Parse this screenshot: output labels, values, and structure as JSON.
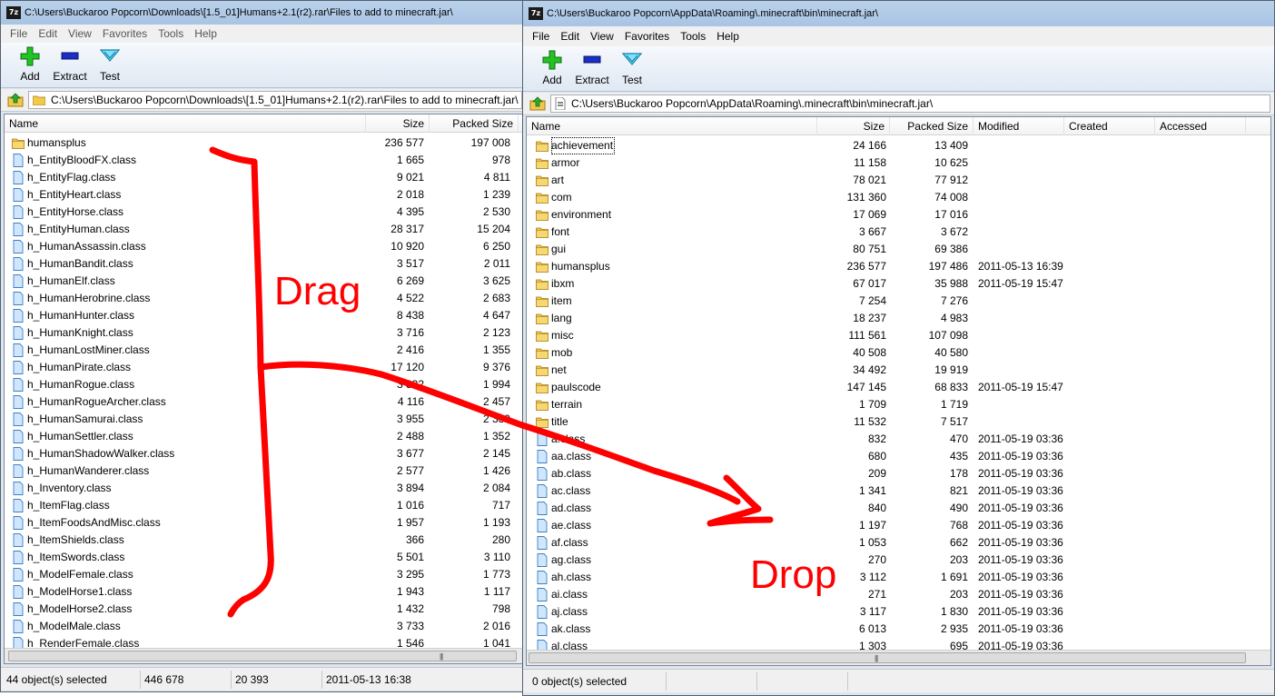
{
  "left": {
    "title": "C:\\Users\\Buckaroo Popcorn\\Downloads\\[1.5_01]Humans+2.1(r2).rar\\Files to add to minecraft.jar\\",
    "app_icon_text": "7z",
    "menu": [
      "File",
      "Edit",
      "View",
      "Favorites",
      "Tools",
      "Help"
    ],
    "toolbar": {
      "add": "Add",
      "extract": "Extract",
      "test": "Test"
    },
    "path": "C:\\Users\\Buckaroo Popcorn\\Downloads\\[1.5_01]Humans+2.1(r2).rar\\Files to add to minecraft.jar\\",
    "columns": {
      "name": "Name",
      "size": "Size",
      "packed": "Packed Size"
    },
    "rows": [
      {
        "name": "humansplus",
        "size": "236 577",
        "packed": "197 008",
        "type": "folder"
      },
      {
        "name": "h_EntityBloodFX.class",
        "size": "1 665",
        "packed": "978",
        "type": "file"
      },
      {
        "name": "h_EntityFlag.class",
        "size": "9 021",
        "packed": "4 811",
        "type": "file"
      },
      {
        "name": "h_EntityHeart.class",
        "size": "2 018",
        "packed": "1 239",
        "type": "file"
      },
      {
        "name": "h_EntityHorse.class",
        "size": "4 395",
        "packed": "2 530",
        "type": "file"
      },
      {
        "name": "h_EntityHuman.class",
        "size": "28 317",
        "packed": "15 204",
        "type": "file"
      },
      {
        "name": "h_HumanAssassin.class",
        "size": "10 920",
        "packed": "6 250",
        "type": "file"
      },
      {
        "name": "h_HumanBandit.class",
        "size": "3 517",
        "packed": "2 011",
        "type": "file"
      },
      {
        "name": "h_HumanElf.class",
        "size": "6 269",
        "packed": "3 625",
        "type": "file"
      },
      {
        "name": "h_HumanHerobrine.class",
        "size": "4 522",
        "packed": "2 683",
        "type": "file"
      },
      {
        "name": "h_HumanHunter.class",
        "size": "8 438",
        "packed": "4 647",
        "type": "file"
      },
      {
        "name": "h_HumanKnight.class",
        "size": "3 716",
        "packed": "2 123",
        "type": "file"
      },
      {
        "name": "h_HumanLostMiner.class",
        "size": "2 416",
        "packed": "1 355",
        "type": "file"
      },
      {
        "name": "h_HumanPirate.class",
        "size": "17 120",
        "packed": "9 376",
        "type": "file"
      },
      {
        "name": "h_HumanRogue.class",
        "size": "3 332",
        "packed": "1 994",
        "type": "file"
      },
      {
        "name": "h_HumanRogueArcher.class",
        "size": "4 116",
        "packed": "2 457",
        "type": "file"
      },
      {
        "name": "h_HumanSamurai.class",
        "size": "3 955",
        "packed": "2 339",
        "type": "file"
      },
      {
        "name": "h_HumanSettler.class",
        "size": "2 488",
        "packed": "1 352",
        "type": "file"
      },
      {
        "name": "h_HumanShadowWalker.class",
        "size": "3 677",
        "packed": "2 145",
        "type": "file"
      },
      {
        "name": "h_HumanWanderer.class",
        "size": "2 577",
        "packed": "1 426",
        "type": "file"
      },
      {
        "name": "h_Inventory.class",
        "size": "3 894",
        "packed": "2 084",
        "type": "file"
      },
      {
        "name": "h_ItemFlag.class",
        "size": "1 016",
        "packed": "717",
        "type": "file"
      },
      {
        "name": "h_ItemFoodsAndMisc.class",
        "size": "1 957",
        "packed": "1 193",
        "type": "file"
      },
      {
        "name": "h_ItemShields.class",
        "size": "366",
        "packed": "280",
        "type": "file"
      },
      {
        "name": "h_ItemSwords.class",
        "size": "5 501",
        "packed": "3 110",
        "type": "file"
      },
      {
        "name": "h_ModelFemale.class",
        "size": "3 295",
        "packed": "1 773",
        "type": "file"
      },
      {
        "name": "h_ModelHorse1.class",
        "size": "1 943",
        "packed": "1 117",
        "type": "file"
      },
      {
        "name": "h_ModelHorse2.class",
        "size": "1 432",
        "packed": "798",
        "type": "file"
      },
      {
        "name": "h_ModelMale.class",
        "size": "3 733",
        "packed": "2 016",
        "type": "file"
      },
      {
        "name": "h_RenderFemale.class",
        "size": "1 546",
        "packed": "1 041",
        "type": "file"
      }
    ],
    "status": {
      "selected": "44 object(s) selected",
      "size": "446 678",
      "packed": "20 393",
      "modified": "2011-05-13 16:38"
    }
  },
  "right": {
    "title": "C:\\Users\\Buckaroo Popcorn\\AppData\\Roaming\\.minecraft\\bin\\minecraft.jar\\",
    "app_icon_text": "7z",
    "menu": [
      "File",
      "Edit",
      "View",
      "Favorites",
      "Tools",
      "Help"
    ],
    "toolbar": {
      "add": "Add",
      "extract": "Extract",
      "test": "Test"
    },
    "path": "C:\\Users\\Buckaroo Popcorn\\AppData\\Roaming\\.minecraft\\bin\\minecraft.jar\\",
    "columns": {
      "name": "Name",
      "size": "Size",
      "packed": "Packed Size",
      "modified": "Modified",
      "created": "Created",
      "accessed": "Accessed"
    },
    "rows": [
      {
        "name": "achievement",
        "size": "24 166",
        "packed": "13 409",
        "modified": "",
        "type": "folder"
      },
      {
        "name": "armor",
        "size": "11 158",
        "packed": "10 625",
        "modified": "",
        "type": "folder"
      },
      {
        "name": "art",
        "size": "78 021",
        "packed": "77 912",
        "modified": "",
        "type": "folder"
      },
      {
        "name": "com",
        "size": "131 360",
        "packed": "74 008",
        "modified": "",
        "type": "folder"
      },
      {
        "name": "environment",
        "size": "17 069",
        "packed": "17 016",
        "modified": "",
        "type": "folder"
      },
      {
        "name": "font",
        "size": "3 667",
        "packed": "3 672",
        "modified": "",
        "type": "folder"
      },
      {
        "name": "gui",
        "size": "80 751",
        "packed": "69 386",
        "modified": "",
        "type": "folder"
      },
      {
        "name": "humansplus",
        "size": "236 577",
        "packed": "197 486",
        "modified": "2011-05-13 16:39",
        "type": "folder"
      },
      {
        "name": "ibxm",
        "size": "67 017",
        "packed": "35 988",
        "modified": "2011-05-19 15:47",
        "type": "folder"
      },
      {
        "name": "item",
        "size": "7 254",
        "packed": "7 276",
        "modified": "",
        "type": "folder"
      },
      {
        "name": "lang",
        "size": "18 237",
        "packed": "4 983",
        "modified": "",
        "type": "folder"
      },
      {
        "name": "misc",
        "size": "111 561",
        "packed": "107 098",
        "modified": "",
        "type": "folder"
      },
      {
        "name": "mob",
        "size": "40 508",
        "packed": "40 580",
        "modified": "",
        "type": "folder"
      },
      {
        "name": "net",
        "size": "34 492",
        "packed": "19 919",
        "modified": "",
        "type": "folder"
      },
      {
        "name": "paulscode",
        "size": "147 145",
        "packed": "68 833",
        "modified": "2011-05-19 15:47",
        "type": "folder"
      },
      {
        "name": "terrain",
        "size": "1 709",
        "packed": "1 719",
        "modified": "",
        "type": "folder"
      },
      {
        "name": "title",
        "size": "11 532",
        "packed": "7 517",
        "modified": "",
        "type": "folder"
      },
      {
        "name": "a.class",
        "size": "832",
        "packed": "470",
        "modified": "2011-05-19 03:36",
        "type": "file"
      },
      {
        "name": "aa.class",
        "size": "680",
        "packed": "435",
        "modified": "2011-05-19 03:36",
        "type": "file"
      },
      {
        "name": "ab.class",
        "size": "209",
        "packed": "178",
        "modified": "2011-05-19 03:36",
        "type": "file"
      },
      {
        "name": "ac.class",
        "size": "1 341",
        "packed": "821",
        "modified": "2011-05-19 03:36",
        "type": "file"
      },
      {
        "name": "ad.class",
        "size": "840",
        "packed": "490",
        "modified": "2011-05-19 03:36",
        "type": "file"
      },
      {
        "name": "ae.class",
        "size": "1 197",
        "packed": "768",
        "modified": "2011-05-19 03:36",
        "type": "file"
      },
      {
        "name": "af.class",
        "size": "1 053",
        "packed": "662",
        "modified": "2011-05-19 03:36",
        "type": "file"
      },
      {
        "name": "ag.class",
        "size": "270",
        "packed": "203",
        "modified": "2011-05-19 03:36",
        "type": "file"
      },
      {
        "name": "ah.class",
        "size": "3 112",
        "packed": "1 691",
        "modified": "2011-05-19 03:36",
        "type": "file"
      },
      {
        "name": "ai.class",
        "size": "271",
        "packed": "203",
        "modified": "2011-05-19 03:36",
        "type": "file"
      },
      {
        "name": "aj.class",
        "size": "3 117",
        "packed": "1 830",
        "modified": "2011-05-19 03:36",
        "type": "file"
      },
      {
        "name": "ak.class",
        "size": "6 013",
        "packed": "2 935",
        "modified": "2011-05-19 03:36",
        "type": "file"
      },
      {
        "name": "al.class",
        "size": "1 303",
        "packed": "695",
        "modified": "2011-05-19 03:36",
        "type": "file"
      }
    ],
    "status": {
      "selected": "0 object(s) selected"
    }
  },
  "annotations": {
    "drag": "Drag",
    "drop": "Drop"
  },
  "icons": {
    "app": "7zip-icon",
    "add": "plus-icon",
    "extract": "minus-icon",
    "test": "check-icon",
    "up": "up-arrow-icon",
    "folder": "folder-icon",
    "file": "file-icon",
    "archive": "archive-icon"
  },
  "colors": {
    "annotation": "#ff0000",
    "titlebar": "#b9d1ea",
    "folder": "#f2c94c",
    "file_icon": "#cfe6ff",
    "add_icon": "#22c322",
    "extract_icon": "#1a2fc7",
    "test_icon": "#29b7e6"
  }
}
